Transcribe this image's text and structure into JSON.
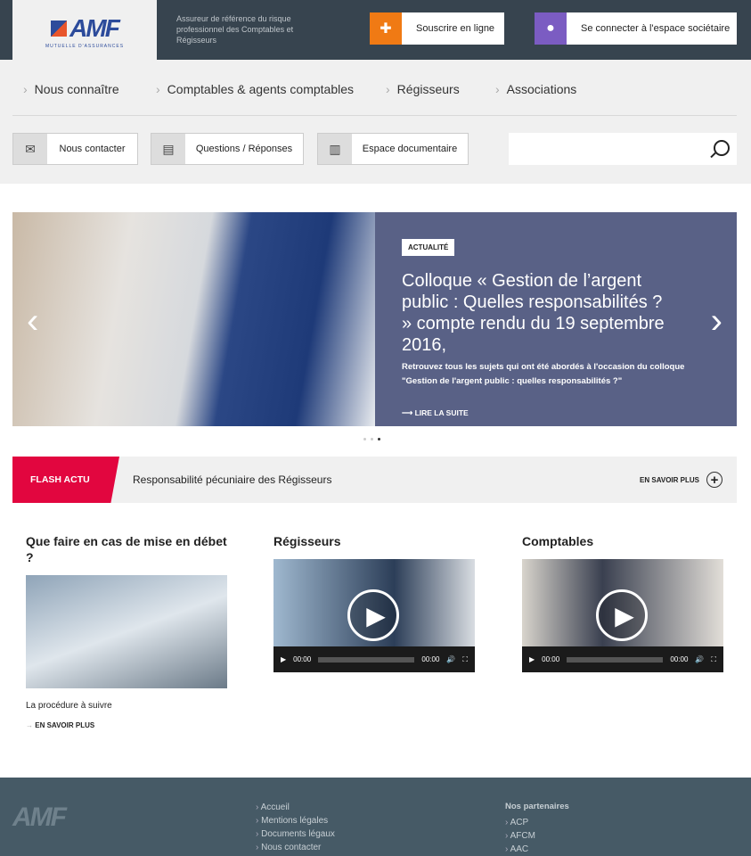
{
  "header": {
    "logo_text": "AMF",
    "logo_sub": "MUTUELLE D'ASSURANCES",
    "tagline": "Assureur de référence du risque professionnel des Comptables et Régisseurs",
    "subscribe": "Souscrire en ligne",
    "login": "Se connecter à l'espace sociétaire",
    "colors": {
      "dark": "#37444f",
      "orange": "#f07a14",
      "purple": "#7b5cc2"
    }
  },
  "nav": {
    "items": [
      "Nous connaître",
      "Comptables & agents comptables",
      "Régisseurs",
      "Associations"
    ]
  },
  "quick": {
    "contact": "Nous contacter",
    "faq": "Questions / Réponses",
    "docs": "Espace documentaire",
    "search_placeholder": ""
  },
  "slider": {
    "badge": "ACTUALITÉ",
    "title": "Colloque « Gestion de l’argent public : Quelles responsabilités ? » compte rendu du 19 septembre 2016,",
    "description": "Retrouvez tous les sujets qui ont été abordés à l'occasion du colloque \"Gestion de l'argent public : quelles responsabilités ?\"",
    "more": "LIRE LA SUITE",
    "active_slide": 3,
    "slide_count": 3
  },
  "flash": {
    "tag": "FLASH ACTU",
    "message": "Responsabilité pécuniaire des Régisseurs",
    "more": "EN SAVOIR PLUS",
    "color": "#e2063f"
  },
  "columns": [
    {
      "title": "Que faire en cas de mise en débet ?",
      "caption": "La procédure à suivre",
      "more": "EN SAVOIR PLUS"
    },
    {
      "title": "Régisseurs",
      "time": "00:00",
      "duration": "00:00"
    },
    {
      "title": "Comptables",
      "time": "00:00",
      "duration": "00:00"
    }
  ],
  "footer": {
    "logo_text": "AMF",
    "links": [
      "Accueil",
      "Mentions légales",
      "Documents légaux",
      "Nous contacter"
    ],
    "partners_title": "Nos partenaires",
    "partners": [
      "ACP",
      "AFCM",
      "AAC"
    ]
  }
}
